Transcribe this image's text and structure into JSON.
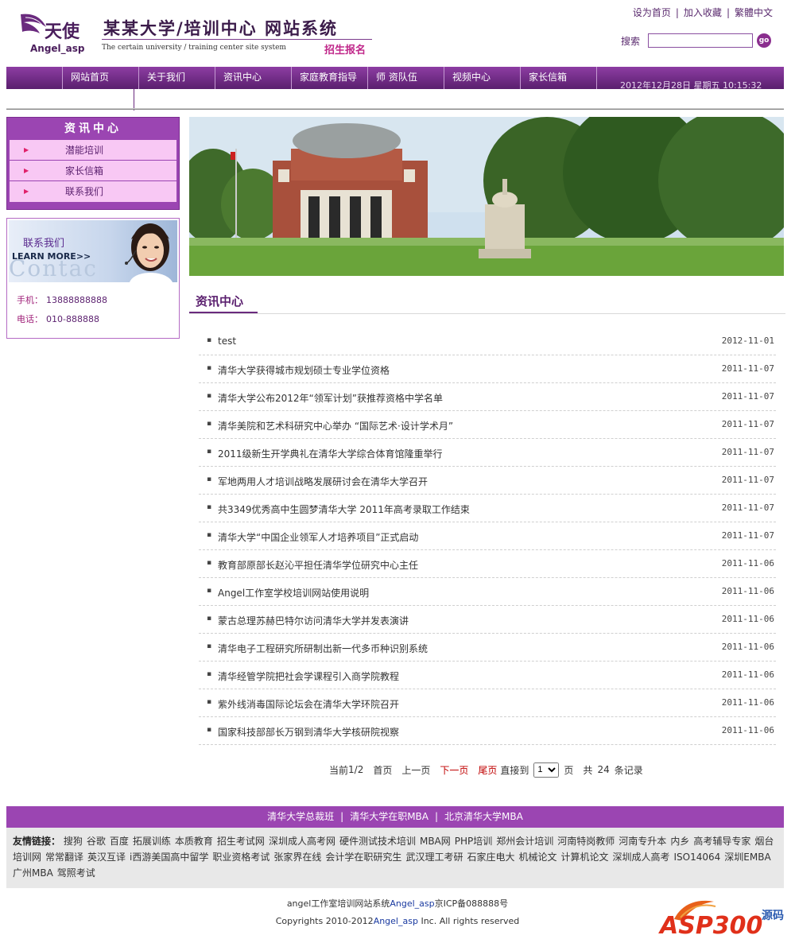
{
  "header": {
    "logo_cn": "天使",
    "logo_en": "Angel_asp",
    "site_title": "某某大学/培训中心 网站系统",
    "site_subtitle": "The certain university / training center site system",
    "enroll": "招生报名",
    "top_links": [
      "设为首页",
      "加入收藏",
      "繁體中文"
    ],
    "search_label": "搜索",
    "search_value": "",
    "go_label": "go"
  },
  "nav": {
    "items": [
      "网站首页",
      "关于我们",
      "资讯中心",
      "家庭教育指导",
      "师 资队伍",
      "视频中心",
      "家长信箱"
    ],
    "date_text": "2012年12月28日  星期五  10:15:32"
  },
  "sidebar": {
    "info_title": "资讯中心",
    "info_items": [
      "潜能培训",
      "家长信箱",
      "联系我们"
    ],
    "contact_title": "联系我们",
    "contact_learn": "LEARN MORE>>",
    "contact_ghost": "Contac",
    "phone_label": "手机：",
    "phone_value": "13888888888",
    "tel_label": "电话：",
    "tel_value": "010-888888"
  },
  "main": {
    "section_title": "资讯中心",
    "news": [
      {
        "title": "test",
        "date": "2012-11-01"
      },
      {
        "title": "清华大学获得城市规划硕士专业学位资格",
        "date": "2011-11-07"
      },
      {
        "title": "清华大学公布2012年“领军计划”获推荐资格中学名单",
        "date": "2011-11-07"
      },
      {
        "title": "清华美院和艺术科研究中心举办 “国际艺术·设计学术月”",
        "date": "2011-11-07"
      },
      {
        "title": "2011级新生开学典礼在清华大学综合体育馆隆重举行",
        "date": "2011-11-07"
      },
      {
        "title": "军地两用人才培训战略发展研讨会在清华大学召开",
        "date": "2011-11-07"
      },
      {
        "title": "共3349优秀高中生圆梦清华大学 2011年高考录取工作结束",
        "date": "2011-11-07"
      },
      {
        "title": "清华大学“中国企业领军人才培养项目”正式启动",
        "date": "2011-11-07"
      },
      {
        "title": "教育部原部长赵沁平担任清华学位研究中心主任",
        "date": "2011-11-06"
      },
      {
        "title": "Angel工作室学校培训网站使用说明",
        "date": "2011-11-06"
      },
      {
        "title": "蒙古总理苏赫巴特尔访问清华大学并发表演讲",
        "date": "2011-11-06"
      },
      {
        "title": "清华电子工程研究所研制出新一代多币种识别系统",
        "date": "2011-11-06"
      },
      {
        "title": "清华经管学院把社会学课程引入商学院教程",
        "date": "2011-11-06"
      },
      {
        "title": "紫外线消毒国际论坛会在清华大学环院召开",
        "date": "2011-11-06"
      },
      {
        "title": "国家科技部部长万钢到清华大学核研院视察",
        "date": "2011-11-06"
      }
    ],
    "pager": {
      "current_prefix": "当前",
      "current": "1/2",
      "first": "首页",
      "prev": "上一页",
      "next": "下一页",
      "last": "尾页",
      "goto_label": "直接到",
      "page_value": "1",
      "page_suffix": "页",
      "total_prefix": "共",
      "total": "24",
      "total_suffix": "条记录"
    }
  },
  "footer": {
    "bar_links": [
      "清华大学总裁班",
      "清华大学在职MBA",
      "北京清华大学MBA"
    ],
    "friend_label": "友情链接：",
    "friend_links": [
      "搜狗",
      "谷歌",
      "百度",
      "拓展训练",
      "本质教育",
      "招生考试网",
      "深圳成人高考网",
      "硬件测试技术培训",
      "MBA网",
      "PHP培训",
      "郑州会计培训",
      "河南特岗教师",
      "河南专升本",
      "内乡",
      "高考辅导专家",
      "烟台培训网",
      "常常翻译",
      "英汉互译",
      "i西游美国高中留学",
      "职业资格考试",
      "张家界在线",
      "会计学在职研究生",
      "武汉理工考研",
      "石家庄电大",
      "机械论文",
      "计算机论文",
      "深圳成人高考",
      "ISO14064",
      "深圳EMBA",
      "广州MBA",
      "驾照考试"
    ],
    "copy1_pre": "angel工作室培训网站系统",
    "copy1_brand": "Angel_asp",
    "copy1_post": "京ICP备088888号",
    "copy2_pre": "Copyrights 2010-2012",
    "copy2_brand": "Angel_asp",
    "copy2_post": " Inc. All rights reserved",
    "watermark": "ASP300",
    "watermark_sub": "源码"
  },
  "colors": {
    "brand_purple": "#9b45b2",
    "nav_dark": "#5a1f6e",
    "pager_red": "#c00000"
  }
}
